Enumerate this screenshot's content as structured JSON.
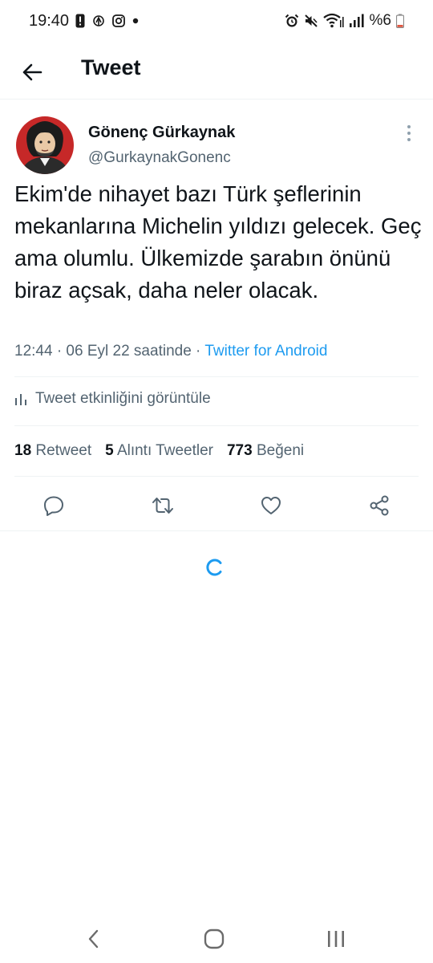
{
  "status_bar": {
    "time": "19:40",
    "left_icons": [
      "notification-alert-icon",
      "network-icon",
      "instagram-icon",
      "dot-icon"
    ],
    "right_icons": [
      "alarm-icon",
      "mute-icon",
      "wifi-icon",
      "signal-icon"
    ],
    "battery": "%6"
  },
  "header": {
    "title": "Tweet"
  },
  "tweet": {
    "author_name": "Gönenç Gürkaynak",
    "author_handle": "@GurkaynakGonenc",
    "text": "Ekim'de nihayet bazı Türk şeflerinin mekanlarına Michelin yıldızı gelecek. Geç ama olumlu. Ülkemizde şarabın önünü biraz açsak, daha neler olacak.",
    "time": "12:44 · 06 Eyl 22 saatinde · ",
    "source": "Twitter for Android",
    "analytics_label": "Tweet etkinliğini görüntüle",
    "stats": {
      "retweets_count": "18",
      "retweets_label": "Retweet",
      "quotes_count": "5",
      "quotes_label": "Alıntı Tweetler",
      "likes_count": "773",
      "likes_label": "Beğeni"
    }
  },
  "colors": {
    "accent": "#1d9bf0",
    "text_primary": "#0f1419",
    "text_secondary": "#536471",
    "divider": "#eff3f4"
  }
}
